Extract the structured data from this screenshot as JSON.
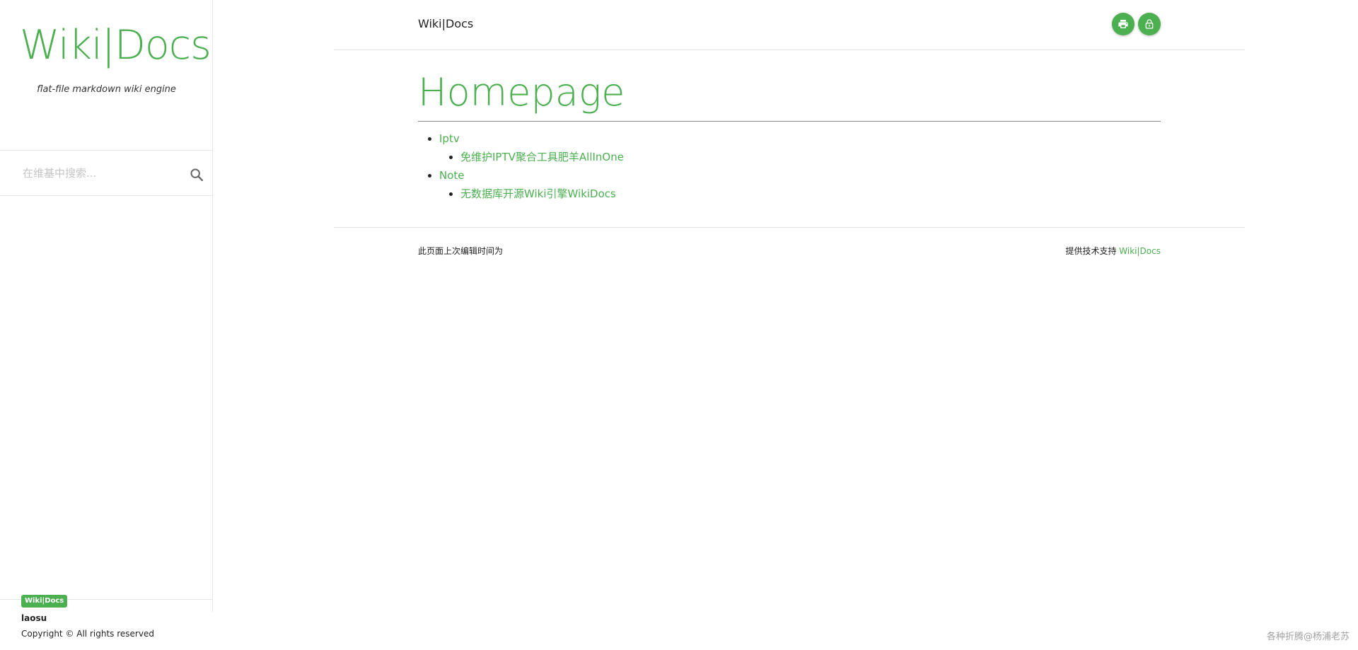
{
  "sidebar": {
    "logo": "Wiki|Docs",
    "tagline": "flat-file markdown wiki engine",
    "search": {
      "placeholder": "在维基中搜索..."
    },
    "footer": {
      "badge": "Wiki|Docs",
      "user": "laosu",
      "copyright": "Copyright © All rights reserved"
    }
  },
  "header": {
    "title": "Wiki|Docs",
    "print_icon": "print-icon",
    "lock_icon": "lock-icon"
  },
  "main": {
    "title": "Homepage",
    "items": [
      {
        "label": "Iptv",
        "children": [
          {
            "label": "免维护IPTV聚合工具肥羊AllInOne"
          }
        ]
      },
      {
        "label": "Note",
        "children": [
          {
            "label": "无数据库开源Wiki引擎WikiDocs"
          }
        ]
      }
    ]
  },
  "footer": {
    "last_edited": "此页面上次编辑时间为",
    "powered_prefix": "提供技术支持",
    "powered_link": "Wiki|Docs"
  },
  "watermark": "各种折腾@杨浦老苏",
  "colors": {
    "accent": "#4caf50"
  }
}
